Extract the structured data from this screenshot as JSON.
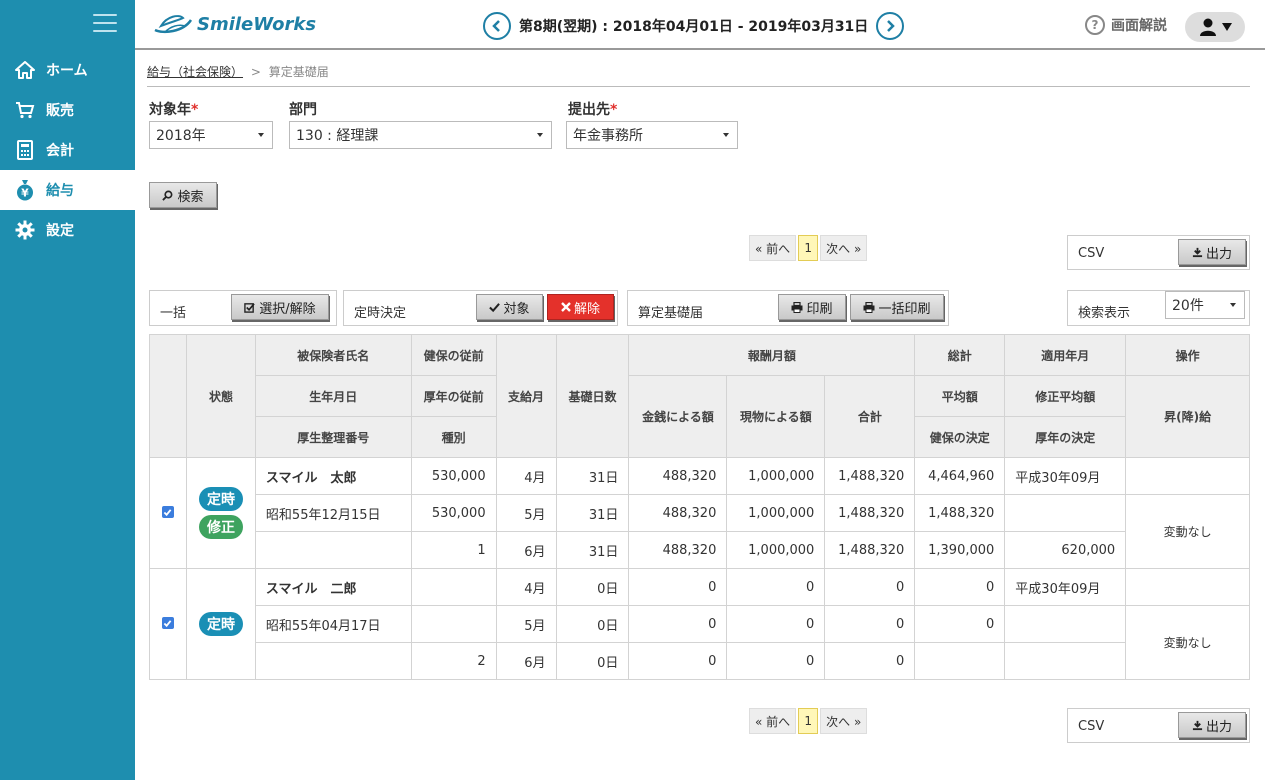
{
  "app": {
    "logo": "SmileWorks"
  },
  "header": {
    "period": "第8期(翌期) : 2018年04月01日 - 2019年03月31日",
    "help": "画面解説"
  },
  "sidebar": {
    "items": [
      {
        "label": "ホーム"
      },
      {
        "label": "販売"
      },
      {
        "label": "会計"
      },
      {
        "label": "給与"
      },
      {
        "label": "設定"
      }
    ]
  },
  "breadcrumb": {
    "parent": "給与（社会保険）",
    "sep": ">",
    "current": "算定基礎届"
  },
  "filters": {
    "year_label": "対象年",
    "year_value": "2018年",
    "dept_label": "部門",
    "dept_value": "130 : 経理課",
    "dest_label": "提出先",
    "dest_value": "年金事務所",
    "req": "*",
    "search_btn": "検索"
  },
  "pager": {
    "prev": "« 前へ",
    "page": "1",
    "next": "次へ »"
  },
  "csv": {
    "label": "CSV",
    "btn": "出力"
  },
  "actions": {
    "bulk_label": "一括",
    "bulk_btn": "選択/解除",
    "fixed_label": "定時決定",
    "target_btn": "対象",
    "cancel_btn": "解除",
    "calc_label": "算定基礎届",
    "print_btn": "印刷",
    "bulk_print_btn": "一括印刷",
    "display_label": "検索表示",
    "display_value": "20件"
  },
  "table": {
    "headers": {
      "status": "状態",
      "name": "被保険者氏名",
      "birth": "生年月日",
      "pension_no": "厚生整理番号",
      "kenpo_prev": "健保の従前",
      "kounen_prev": "厚年の従前",
      "kind": "種別",
      "pay_month": "支給月",
      "days": "基礎日数",
      "remuneration": "報酬月額",
      "cash": "金銭による額",
      "goods": "現物による額",
      "subtotal": "合計",
      "total": "総計",
      "average": "平均額",
      "kenpo_decision": "健保の決定",
      "apply_month": "適用年月",
      "revised_avg": "修正平均額",
      "kounen_decision": "厚年の決定",
      "operation": "操作",
      "raise": "昇(降)給"
    },
    "records": [
      {
        "badges": [
          "定時",
          "修正"
        ],
        "op": "変動なし",
        "rows": [
          {
            "info": "スマイル　太郎",
            "prev": "530,000",
            "month": "4月",
            "days": "31日",
            "cash": "488,320",
            "goods": "1,000,000",
            "sum": "1,488,320",
            "total": "4,464,960",
            "apply": "平成30年09月"
          },
          {
            "info": "昭和55年12月15日",
            "prev": "530,000",
            "month": "5月",
            "days": "31日",
            "cash": "488,320",
            "goods": "1,000,000",
            "sum": "1,488,320",
            "total": "1,488,320",
            "apply": ""
          },
          {
            "info": "",
            "prev": "1",
            "month": "6月",
            "days": "31日",
            "cash": "488,320",
            "goods": "1,000,000",
            "sum": "1,488,320",
            "total": "1,390,000",
            "apply": "620,000"
          }
        ]
      },
      {
        "badges": [
          "定時"
        ],
        "op": "変動なし",
        "rows": [
          {
            "info": "スマイル　二郎",
            "prev": "",
            "month": "4月",
            "days": "0日",
            "cash": "0",
            "goods": "0",
            "sum": "0",
            "total": "0",
            "apply": "平成30年09月"
          },
          {
            "info": "昭和55年04月17日",
            "prev": "",
            "month": "5月",
            "days": "0日",
            "cash": "0",
            "goods": "0",
            "sum": "0",
            "total": "0",
            "apply": ""
          },
          {
            "info": "",
            "prev": "2",
            "month": "6月",
            "days": "0日",
            "cash": "0",
            "goods": "0",
            "sum": "0",
            "total": "",
            "apply": ""
          }
        ]
      }
    ]
  }
}
